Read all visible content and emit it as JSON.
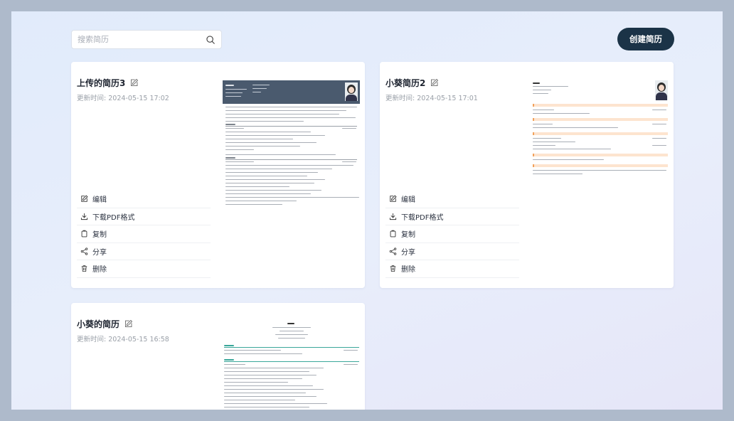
{
  "search": {
    "placeholder": "搜索简历",
    "icon": "search-icon"
  },
  "create_button": {
    "label": "创建简历"
  },
  "time_label": "更新时间:",
  "actions": [
    {
      "label": "编辑",
      "icon": "edit-icon"
    },
    {
      "label": "下载PDF格式",
      "icon": "download-icon"
    },
    {
      "label": "复制",
      "icon": "copy-icon"
    },
    {
      "label": "分享",
      "icon": "share-icon"
    },
    {
      "label": "删除",
      "icon": "trash-icon"
    }
  ],
  "cards": [
    {
      "title": "上传的简历3",
      "updated": "2024-05-15 17:02",
      "preview_style": "dark-header"
    },
    {
      "title": "小葵简历2",
      "updated": "2024-05-15 17:01",
      "preview_style": "orange-sections"
    },
    {
      "title": "小葵的简历",
      "updated": "2024-05-15 16:58",
      "preview_style": "centered-header"
    }
  ],
  "colors": {
    "page_bg": "#aebacb",
    "button_bg": "#1b3347",
    "resume_header": "#4a5a6e",
    "orange_accent": "#f2a25c",
    "green_accent": "#3aa79a"
  }
}
